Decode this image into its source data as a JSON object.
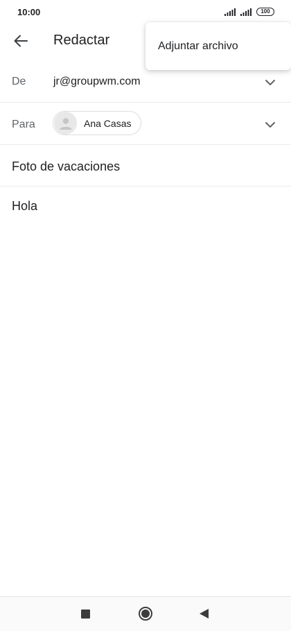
{
  "status_bar": {
    "time": "10:00",
    "battery": "100",
    "icons": [
      "signal-icon",
      "signal-icon",
      "battery-icon"
    ]
  },
  "app_bar": {
    "title": "Redactar",
    "back_icon": "arrow-left-icon"
  },
  "overflow_menu": {
    "items": [
      {
        "label": "Adjuntar archivo"
      }
    ]
  },
  "compose": {
    "from": {
      "label": "De",
      "value": "jr@groupwm.com",
      "icon": "chevron-down-icon"
    },
    "to": {
      "label": "Para",
      "recipients": [
        {
          "name": "Ana Casas",
          "icon": "person-icon"
        }
      ],
      "icon": "chevron-down-icon"
    },
    "subject": "Foto de vacaciones",
    "body": "Hola"
  },
  "nav_bar": {
    "icons": [
      "recents-icon",
      "home-icon",
      "back-icon"
    ]
  },
  "colors": {
    "text": "#202124",
    "label": "#5f6368",
    "divider": "#ececec",
    "chip_border": "#dadce0"
  }
}
